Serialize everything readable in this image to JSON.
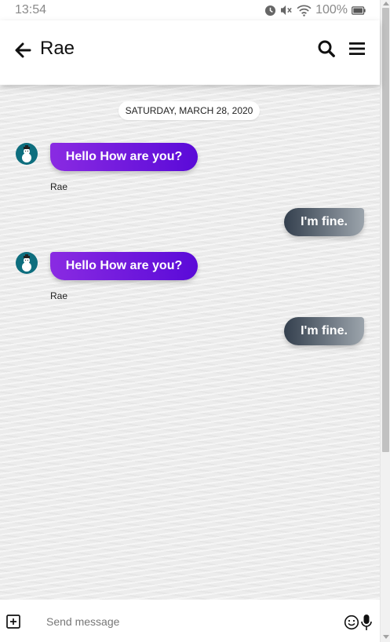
{
  "status_bar": {
    "time": "13:54",
    "battery": "100%",
    "icons": [
      "alarm-icon",
      "mute-icon",
      "wifi-icon",
      "battery-icon"
    ]
  },
  "header": {
    "title": "Rae",
    "icons": {
      "back": "arrow-left-icon",
      "search": "search-icon",
      "menu": "hamburger-menu-icon"
    }
  },
  "chat": {
    "date_label": "SATURDAY, MARCH 28, 2020",
    "messages": [
      {
        "direction": "incoming",
        "text": "Hello How are you?",
        "sender": "Rae"
      },
      {
        "direction": "outgoing",
        "text": "I'm fine."
      },
      {
        "direction": "incoming",
        "text": "Hello How are you?",
        "sender": "Rae"
      },
      {
        "direction": "outgoing",
        "text": "I'm fine."
      }
    ]
  },
  "composer": {
    "placeholder": "Send message",
    "value": "",
    "icons": {
      "attach": "plus-square-icon",
      "emoji": "smiley-icon",
      "mic": "microphone-icon"
    }
  },
  "colors": {
    "incoming_gradient": [
      "#8a2be2",
      "#5a0ad8"
    ],
    "outgoing_gradient": [
      "#34404e",
      "#9ca4ac"
    ],
    "avatar_bg": "#0e6e7e"
  }
}
